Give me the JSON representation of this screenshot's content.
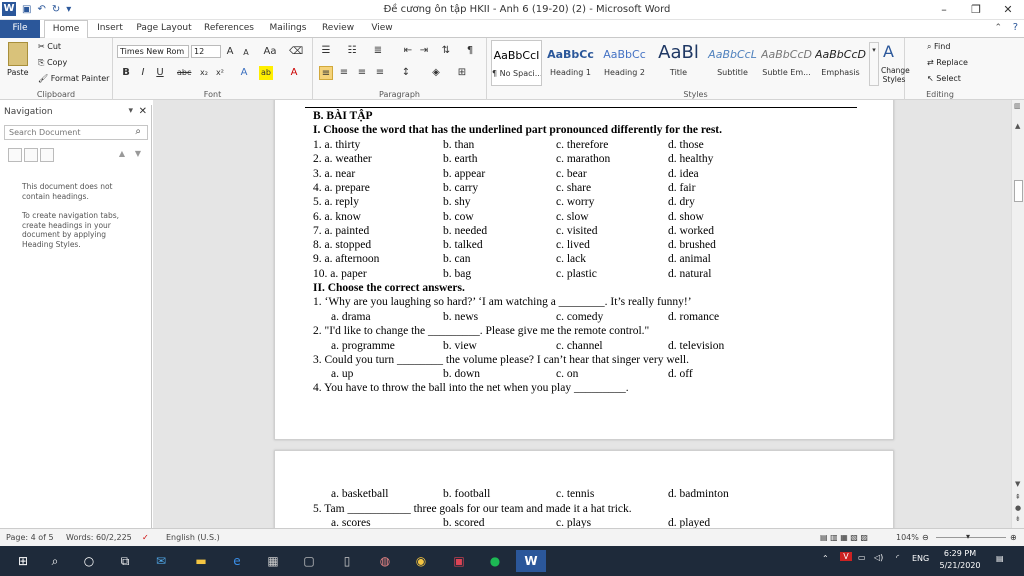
{
  "window": {
    "title": "Đề cương ôn tập HKII - Anh 6 (19-20) (2)  -  Microsoft Word"
  },
  "tabs": [
    "File",
    "Home",
    "Insert",
    "Page Layout",
    "References",
    "Mailings",
    "Review",
    "View"
  ],
  "ribbon": {
    "clipboard": {
      "label": "Clipboard",
      "paste": "Paste",
      "cut": "Cut",
      "copy": "Copy",
      "format_painter": "Format Painter"
    },
    "font": {
      "label": "Font",
      "name": "Times New Rom",
      "size": "12"
    },
    "paragraph": {
      "label": "Paragraph"
    },
    "styles": {
      "label": "Styles",
      "items": [
        {
          "sample": "AaBbCcI",
          "name": "¶ No Spaci..."
        },
        {
          "sample": "AaBbCc",
          "name": "Heading 1"
        },
        {
          "sample": "AaBbCc",
          "name": "Heading 2"
        },
        {
          "sample": "AaBl",
          "name": "Title"
        },
        {
          "sample": "AaBbCcL",
          "name": "Subtitle"
        },
        {
          "sample": "AaBbCcD",
          "name": "Subtle Em..."
        },
        {
          "sample": "AaBbCcD",
          "name": "Emphasis"
        }
      ],
      "change_styles": "Change Styles"
    },
    "editing": {
      "label": "Editing",
      "find": "Find",
      "replace": "Replace",
      "select": "Select"
    }
  },
  "nav": {
    "title": "Navigation",
    "search_placeholder": "Search Document",
    "msg1": "This document does not contain headings.",
    "msg2": "To create navigation tabs, create headings in your document by applying Heading Styles."
  },
  "doc": {
    "section": "B. BÀI TẬP",
    "part1": "I. Choose the word that has the underlined part pronounced differently for the rest.",
    "q1": [
      [
        "1.  a. thirty",
        "b. than",
        "c. therefore",
        "d. those"
      ],
      [
        "2.  a. weather",
        "b. earth",
        "c. marathon",
        "d. healthy"
      ],
      [
        "3.  a. near",
        "b. appear",
        "c. bear",
        "d. idea"
      ],
      [
        "4.  a. prepare",
        "b. carry",
        "c. share",
        "d. fair"
      ],
      [
        "5.  a. reply",
        "b. shy",
        "c. worry",
        "d. dry"
      ],
      [
        "6.  a. know",
        "b. cow",
        "c. slow",
        "d. show"
      ],
      [
        "7.  a. painted",
        "b. needed",
        "c. visited",
        "d. worked"
      ],
      [
        "8.  a. stopped",
        "b. talked",
        "c. lived",
        "d. brushed"
      ],
      [
        "9.  a. afternoon",
        "b. can",
        "c. lack",
        "d. animal"
      ],
      [
        "10. a. paper",
        "b. bag",
        "c. plastic",
        "d. natural"
      ]
    ],
    "part2": "II. Choose the correct answers.",
    "p2_q1": "1. ‘Why are you laughing so hard?’ ‘I am watching a ________. It’s really funny!’",
    "p2_a1": [
      "a. drama",
      "b. news",
      "c. comedy",
      "d. romance"
    ],
    "p2_q2": "2. \"I'd like to change the _________. Please give me the remote control.\"",
    "p2_a2": [
      "a. programme",
      "b. view",
      "c. channel",
      "d. television"
    ],
    "p2_q3": "3. Could you turn ________ the volume please? I can’t hear that singer very well.",
    "p2_a3": [
      "a. up",
      "b. down",
      "c. on",
      "d. off"
    ],
    "p2_q4": "4. You have to throw the ball into the net when you play _________.",
    "p2_a4": [
      "a. basketball",
      "b. football",
      "c. tennis",
      "d. badminton"
    ],
    "p2_q5": "5. Tam ___________ three goals for our team and made it a hat trick.",
    "p2_a5": [
      "a. scores",
      "b. scored",
      "c. plays",
      "d. played"
    ]
  },
  "status": {
    "page": "Page: 4 of 5",
    "words": "Words: 60/2,225",
    "lang": "English (U.S.)",
    "zoom": "104%"
  },
  "taskbar": {
    "lang": "ENG",
    "time": "6:29 PM",
    "date": "5/21/2020"
  }
}
